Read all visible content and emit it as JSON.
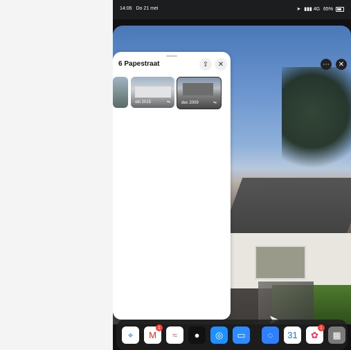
{
  "status_bar": {
    "time": "14:06",
    "date": "Do 21 mei",
    "signal": "4G",
    "battery": "65%"
  },
  "panel": {
    "title": "6 Papestraat"
  },
  "thumbnails": [
    {
      "label": "okt 2015"
    },
    {
      "label": "dec 2009"
    }
  ],
  "dock": {
    "apps": [
      {
        "name": "Google Maps"
      },
      {
        "name": "Gmail",
        "badge": "1"
      },
      {
        "name": "Monday"
      },
      {
        "name": "Camera"
      },
      {
        "name": "Safari"
      },
      {
        "name": "Files"
      },
      {
        "name": "App Store"
      },
      {
        "name": "Calendar",
        "text": "31"
      },
      {
        "name": "Photos",
        "badge": "1"
      },
      {
        "name": "Utilities"
      }
    ]
  }
}
